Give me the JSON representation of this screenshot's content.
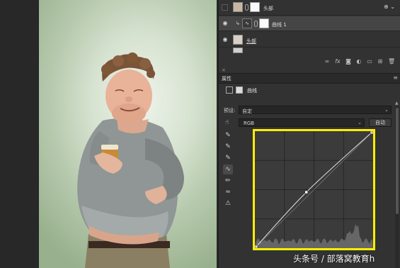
{
  "layers": [
    {
      "name": "头部",
      "visible": false,
      "has_mask": true,
      "linked": true,
      "fx": "",
      "selected": false
    },
    {
      "name": "曲线 1",
      "visible": true,
      "adjustment": "curves",
      "clipped": true,
      "has_mask": true,
      "linked": true,
      "selected": true
    },
    {
      "name": "头部",
      "visible": true,
      "has_mask": false,
      "fx": "",
      "selected": false
    }
  ],
  "layers_toolbar": [
    "link-icon",
    "fx-icon",
    "mask-icon",
    "adjustment-icon",
    "folder-icon",
    "new-layer-icon",
    "trash-icon"
  ],
  "layers_toolbar_fx": "fx",
  "properties": {
    "tab_label": "属性",
    "panel_title": "曲线",
    "preset_label": "预设:",
    "preset_value": "自定",
    "channel_value": "RGB",
    "auto_button": "自动",
    "menu_glyph": "≡",
    "collapse_glyph": "×"
  },
  "icons": {
    "eye": "eye-icon",
    "dropdown": "chevron-down-icon",
    "hand": "on-image-adjust-icon",
    "curve_tools": [
      "eyedropper-black-icon",
      "eyedropper-gray-icon",
      "eyedropper-white-icon",
      "curve-point-icon",
      "pencil-icon",
      "smooth-icon",
      "clipping-warning-icon"
    ]
  },
  "curve": {
    "control_points": [
      [
        0,
        0
      ],
      [
        111,
        122
      ],
      [
        255,
        255
      ]
    ],
    "input_range": [
      0,
      255
    ],
    "output_range": [
      0,
      255
    ]
  },
  "colors": {
    "highlight_box": "#ffee00",
    "panel_bg": "#323232",
    "selected_layer": "#454545"
  },
  "watermark": "头条号 / 部落窝教育h"
}
